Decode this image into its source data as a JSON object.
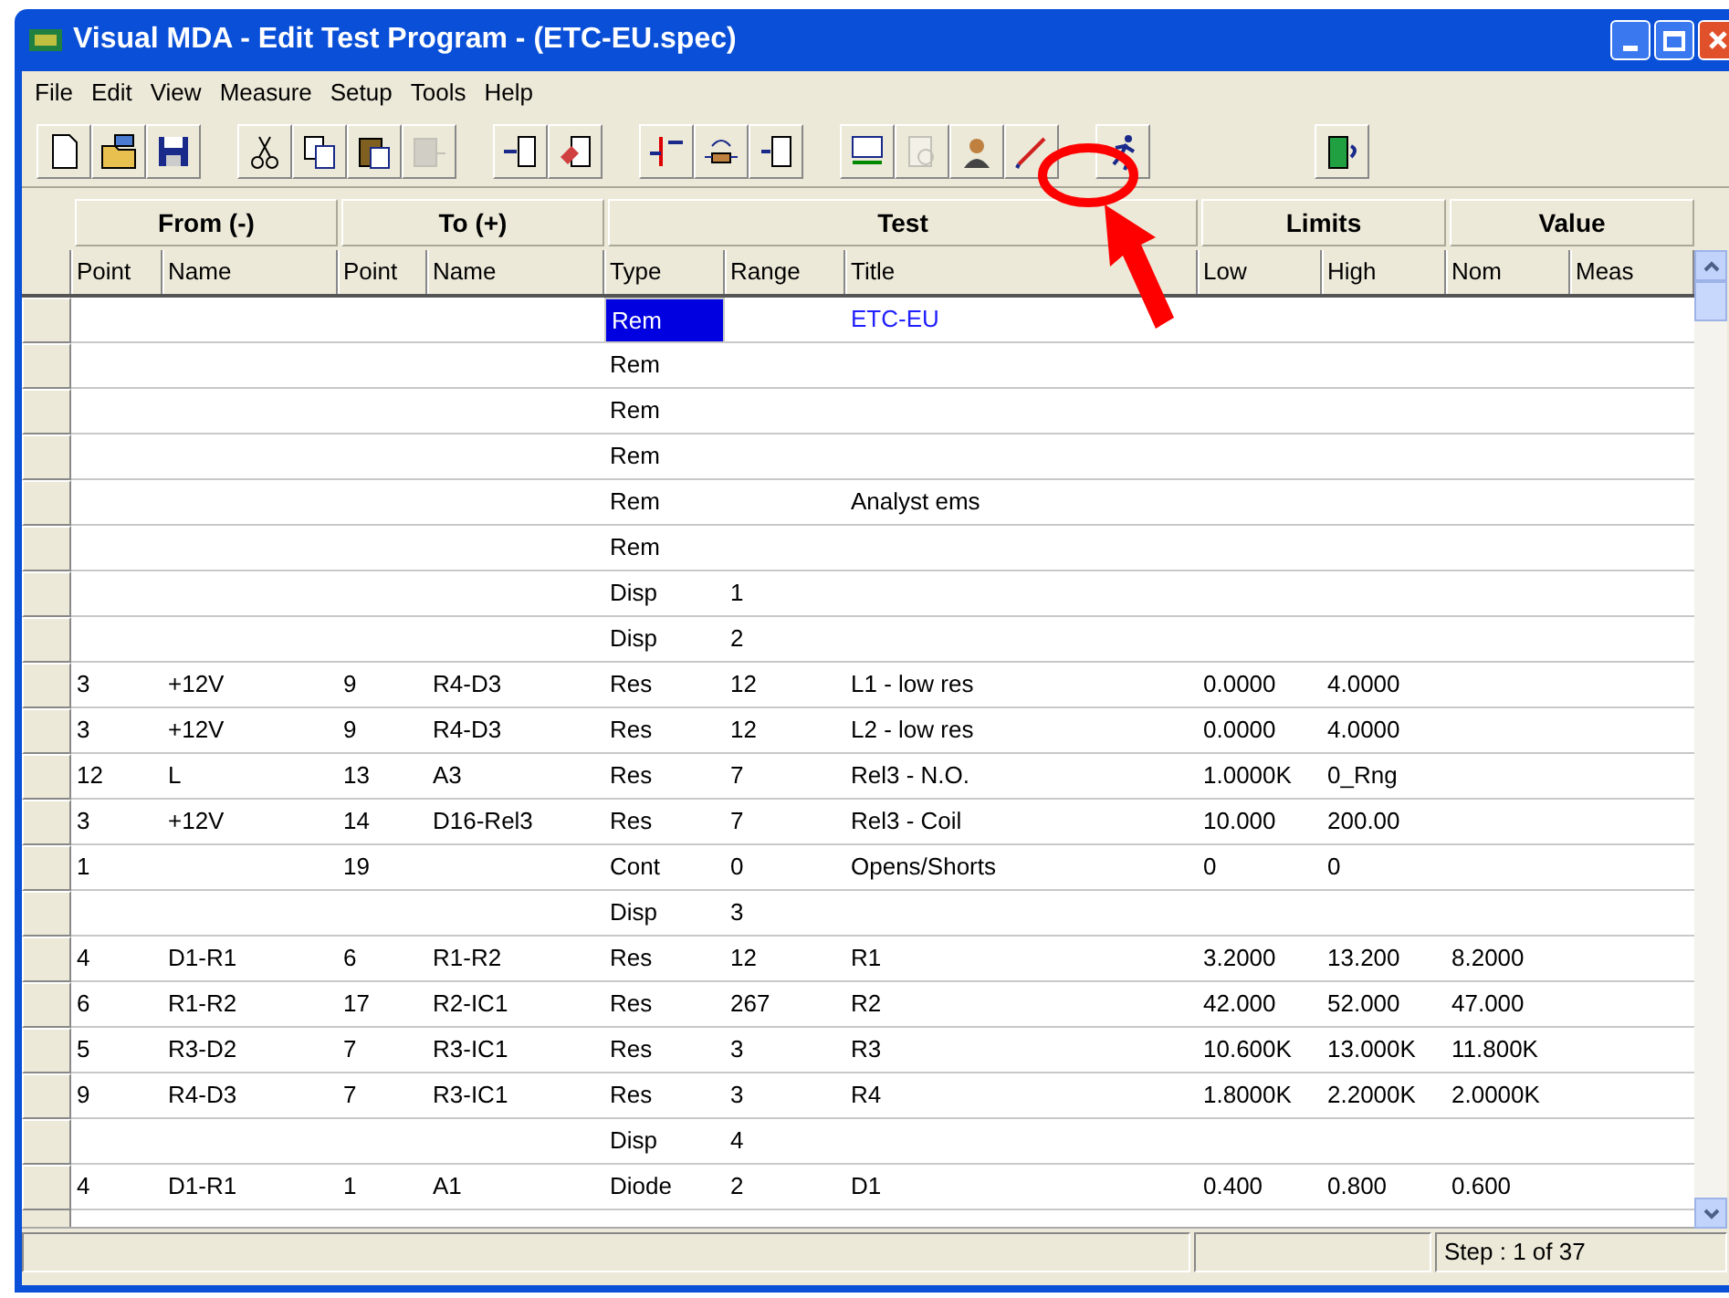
{
  "window": {
    "title": "Visual MDA - Edit Test Program - (ETC-EU.spec)"
  },
  "menu": [
    "File",
    "Edit",
    "View",
    "Measure",
    "Setup",
    "Tools",
    "Help"
  ],
  "groups": [
    "From (-)",
    "To (+)",
    "Test",
    "Limits",
    "Value"
  ],
  "columns": [
    "Point",
    "Name",
    "Point",
    "Name",
    "Type",
    "Range",
    "Title",
    "Low",
    "High",
    "Nom",
    "Meas"
  ],
  "rows": [
    {
      "cells": [
        "",
        "",
        "",
        "",
        "Rem",
        "",
        "ETC-EU",
        "",
        "",
        "",
        ""
      ],
      "type_selected": true,
      "kind": "program-name"
    },
    {
      "cells": [
        "",
        "",
        "",
        "",
        "Rem",
        "",
        "",
        "",
        "",
        "",
        ""
      ],
      "type_selected": false,
      "kind": "step"
    },
    {
      "cells": [
        "",
        "",
        "",
        "",
        "Rem",
        "",
        "",
        "",
        "",
        "",
        ""
      ],
      "type_selected": false,
      "kind": "step"
    },
    {
      "cells": [
        "",
        "",
        "",
        "",
        "Rem",
        "",
        "",
        "",
        "",
        "",
        ""
      ],
      "type_selected": false,
      "kind": "step"
    },
    {
      "cells": [
        "",
        "",
        "",
        "",
        "Rem",
        "",
        "Analyst ems",
        "",
        "",
        "",
        ""
      ],
      "type_selected": false,
      "kind": "step"
    },
    {
      "cells": [
        "",
        "",
        "",
        "",
        "Rem",
        "",
        "",
        "",
        "",
        "",
        ""
      ],
      "type_selected": false,
      "kind": "step"
    },
    {
      "cells": [
        "",
        "",
        "",
        "",
        "Disp",
        "1",
        "",
        "",
        "",
        "",
        ""
      ],
      "type_selected": false,
      "kind": "step"
    },
    {
      "cells": [
        "",
        "",
        "",
        "",
        "Disp",
        "2",
        "",
        "",
        "",
        "",
        ""
      ],
      "type_selected": false,
      "kind": "step"
    },
    {
      "cells": [
        "3",
        "+12V",
        "9",
        "R4-D3",
        "Res",
        "12",
        "L1 - low res",
        "0.0000",
        "4.0000",
        "",
        ""
      ],
      "type_selected": false,
      "kind": "step"
    },
    {
      "cells": [
        "3",
        "+12V",
        "9",
        "R4-D3",
        "Res",
        "12",
        "L2 - low res",
        "0.0000",
        "4.0000",
        "",
        ""
      ],
      "type_selected": false,
      "kind": "step"
    },
    {
      "cells": [
        "12",
        "L",
        "13",
        "A3",
        "Res",
        "7",
        "Rel3 - N.O.",
        "1.0000K",
        "0_Rng",
        "",
        ""
      ],
      "type_selected": false,
      "kind": "step"
    },
    {
      "cells": [
        "3",
        "+12V",
        "14",
        "D16-Rel3",
        "Res",
        "7",
        "Rel3 - Coil",
        "10.000",
        "200.00",
        "",
        ""
      ],
      "type_selected": false,
      "kind": "step"
    },
    {
      "cells": [
        "1",
        "",
        "19",
        "",
        "Cont",
        "0",
        "Opens/Shorts",
        "0",
        "0",
        "",
        ""
      ],
      "type_selected": false,
      "kind": "step"
    },
    {
      "cells": [
        "",
        "",
        "",
        "",
        "Disp",
        "3",
        "",
        "",
        "",
        "",
        ""
      ],
      "type_selected": false,
      "kind": "step"
    },
    {
      "cells": [
        "4",
        "D1-R1",
        "6",
        "R1-R2",
        "Res",
        "12",
        "R1",
        "3.2000",
        "13.200",
        "8.2000",
        ""
      ],
      "type_selected": false,
      "kind": "step"
    },
    {
      "cells": [
        "6",
        "R1-R2",
        "17",
        "R2-IC1",
        "Res",
        "267",
        "R2",
        "42.000",
        "52.000",
        "47.000",
        ""
      ],
      "type_selected": false,
      "kind": "step"
    },
    {
      "cells": [
        "5",
        "R3-D2",
        "7",
        "R3-IC1",
        "Res",
        "3",
        "R3",
        "10.600K",
        "13.000K",
        "11.800K",
        ""
      ],
      "type_selected": false,
      "kind": "step"
    },
    {
      "cells": [
        "9",
        "R4-D3",
        "7",
        "R3-IC1",
        "Res",
        "3",
        "R4",
        "1.8000K",
        "2.2000K",
        "2.0000K",
        ""
      ],
      "type_selected": false,
      "kind": "step"
    },
    {
      "cells": [
        "",
        "",
        "",
        "",
        "Disp",
        "4",
        "",
        "",
        "",
        "",
        ""
      ],
      "type_selected": false,
      "kind": "step"
    },
    {
      "cells": [
        "4",
        "D1-R1",
        "1",
        "A1",
        "Diode",
        "2",
        "D1",
        "0.400",
        "0.800",
        "0.600",
        ""
      ],
      "type_selected": false,
      "kind": "step"
    }
  ],
  "status_bar": {
    "step": "Step : 1 of 37"
  }
}
